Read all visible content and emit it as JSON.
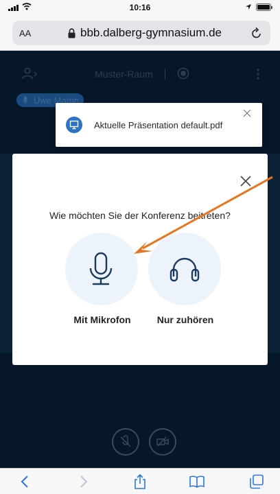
{
  "status_bar": {
    "time": "10:16"
  },
  "browser": {
    "text_size_button": "AA",
    "url": "bbb.dalberg-gymnasium.de"
  },
  "bbb": {
    "room_name": "Muster-Raum",
    "talker_name": "Uwe Martin"
  },
  "toast": {
    "text": "Aktuelle Präsentation default.pdf"
  },
  "audio_modal": {
    "title": "Wie möchten Sie der Konferenz beitreten?",
    "options": [
      {
        "label": "Mit Mikrofon",
        "icon": "microphone-icon"
      },
      {
        "label": "Nur zuhören",
        "icon": "headphones-icon"
      }
    ]
  },
  "controls": {
    "mute_icon": "microphone-off-icon",
    "camera_icon": "camera-off-icon"
  },
  "toolbar": {
    "items": [
      "back-icon",
      "forward-icon",
      "share-icon",
      "bookmarks-icon",
      "tabs-icon"
    ]
  },
  "colors": {
    "accent": "#2d73c3",
    "annotation_arrow": "#e7751f",
    "page_background": "#06172a"
  }
}
